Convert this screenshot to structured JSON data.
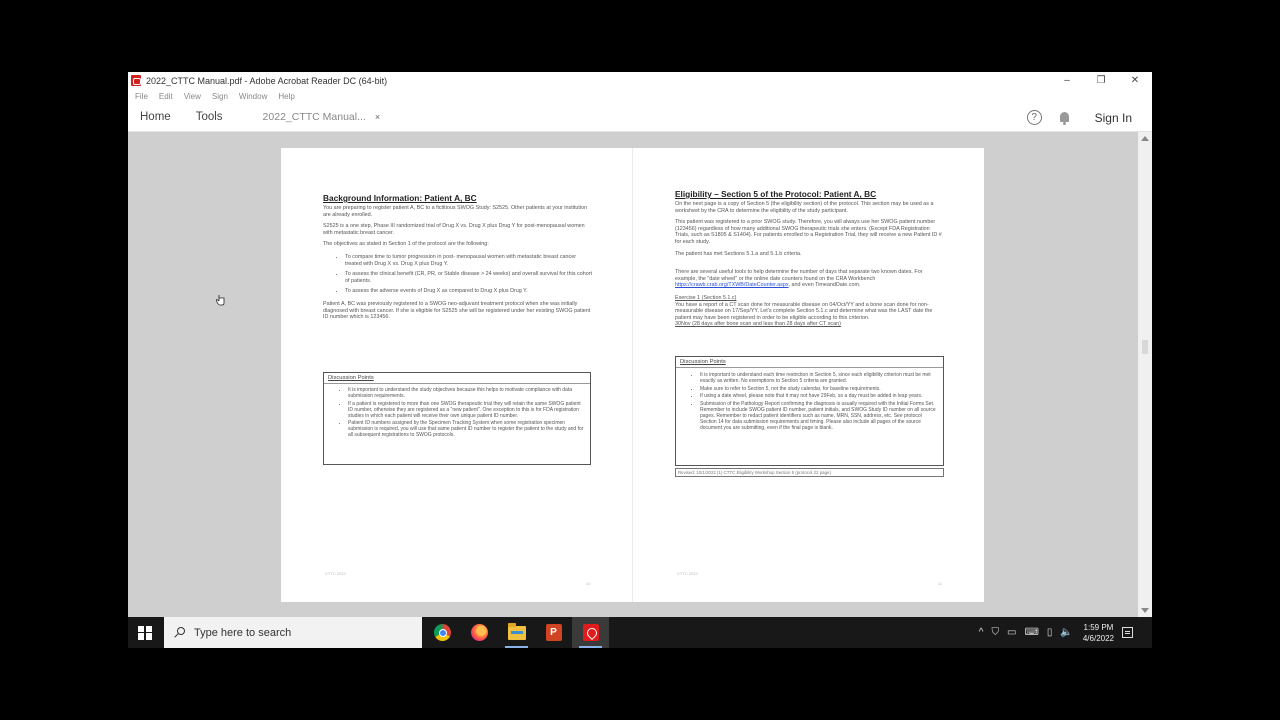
{
  "window": {
    "title": "2022_CTTC Manual.pdf - Adobe Acrobat Reader DC (64-bit)",
    "controls": {
      "minimize": "–",
      "restore": "❐",
      "close": "✕"
    }
  },
  "menu": [
    "File",
    "Edit",
    "View",
    "Sign",
    "Window",
    "Help"
  ],
  "toolbar": {
    "home": "Home",
    "tools": "Tools",
    "doc_tab": "2022_CTTC Manual...",
    "doc_tab_close": "×",
    "help": "?",
    "sign_in": "Sign In"
  },
  "page_left": {
    "heading": "Background Information: Patient A, BC",
    "p1": "You are preparing to register patient A, BC to a fictitious SWOG Study: S2525. Other patients at your institution are already enrolled.",
    "p2": "S2525 is a one step, Phase III randomized trial of Drug X vs. Drug X plus Drug Y for post-menopausal women with metastatic breast cancer.",
    "p3": "The objectives as stated in Section 1 of the protocol are the following:",
    "objectives": [
      "To compare time to tumor progression in post- menopausal women with metastatic breast cancer treated with Drug X vs. Drug X plus Drug Y.",
      "To assess the clinical benefit (CR, PR, or Stable disease > 24 weeks) and overall survival for this cohort of patients.",
      "To assess the adverse events of Drug X as compared to Drug X plus Drug Y."
    ],
    "p4": "Patient A, BC was previously registered to a SWOG neo-adjuvant treatment protocol when she was initially diagnosed with breast cancer. If she is eligible for S2525 she will be registered under her existing SWOG patient ID number which is 123456.",
    "box_title": "Discussion Points",
    "box_points": [
      "It is important to understand the study objectives because this helps to motivate compliance with data submission requirements.",
      "If a patient is registered to more than one SWOG therapeutic trial they will retain the same SWOG patient ID number, otherwise they are registered as a \"new patient\". One exception to this is for FDA registration studies in which each patient will receive their own unique patient ID number.",
      "Patient ID numbers assigned by the Specimen Tracking System when some registration specimen submission is required, you will use that same patient ID number to register the patient to the study and for all subsequent registrations to SWOG protocols."
    ],
    "footer_left": "CTTC 2022",
    "page_number": "10"
  },
  "page_right": {
    "heading": "Eligibility – Section 5 of the Protocol: Patient A, BC",
    "p1": "On the next page is a copy of Section 5 (the eligibility section) of the protocol. This section may be used as a worksheet by the CRA to determine the eligibility of the study participant.",
    "p2": "This patient was registered to a prior SWOG study. Therefore, you will always use her SWOG patient number (123456) regardless of how many additional SWOG therapeutic trials she enters. (Except FDA Registration Trials, such as S1805 & S1404). For patients enrolled to a Registration Trial, they will receive a new Patient ID # for each study.",
    "p3": "The patient has met Sections 5.1.a and 5.1.b criteria.",
    "p4_a": "There are several useful tools to help determine the number of days that separate two known dates. For example, the \"date wheel\" or the online date counters found on the CRA Workbench",
    "p4_link": "https://crawb.crab.org/TXWB/DateCounter.aspx",
    "p4_b": ", and even TimeandDate.com.",
    "exercise_title": "Exercise 1 (Section 5.1.c)",
    "exercise_text": "You have a report of a CT scan done for measurable disease on 04/Oct/YY and a bone scan done for non-measurable disease on 17/Sep/YY. Let's complete Section 5.1.c and determine what was the LAST date the patient may have been registered in order to be eligible according to this criterion.",
    "exercise_answer": "30Nov (28 days after bone scan and less than 28 days after CT scan)",
    "box_title": "Discussion Points",
    "box_points": [
      "It is important to understand each time restriction in Section 5, since each eligibility criterion must be met exactly as written. No exemptions to Section 5 criteria are granted.",
      "Make sure to refer to Section 5, not the study calendar, for baseline requirements.",
      "If using a date wheel, please note that it may not have 29Feb, so a day must be added in leap years.",
      "Submission of the Pathology Report confirming the diagnosis is usually required with the Initial Forms Set. Remember to include SWOG patient ID number, patient initials, and SWOG Study ID number on all source pages. Remember to redact patient identifiers such as name, MRN, SSN, address, etc. See protocol Section 14 for data submission requirements and timing. Please also include all pages of the source document you are submitting, even if the final page is blank."
    ],
    "footnote": "Revised: 10/1/2022 (1) CTTC Eligibility Workshop Section 5 (protocol 22 page)",
    "footer_left": "CTTC 2022",
    "page_number": "11"
  },
  "taskbar": {
    "search_placeholder": "Type here to search",
    "apps": [
      "chrome-icon",
      "firefox-icon",
      "file-explorer-icon",
      "powerpoint-icon",
      "acrobat-icon"
    ],
    "ppt_letter": "P",
    "tray": [
      "^",
      "⛉",
      "▭",
      "⌨",
      "▯",
      "🔈"
    ],
    "time": "1:59 PM",
    "date": "4/6/2022"
  },
  "colors": {
    "title_bar": "#ffffff",
    "doc_background": "#cfcfcf",
    "taskbar": "#181818",
    "link": "#2a4fd6",
    "acrobat_red": "#e01b1b"
  }
}
